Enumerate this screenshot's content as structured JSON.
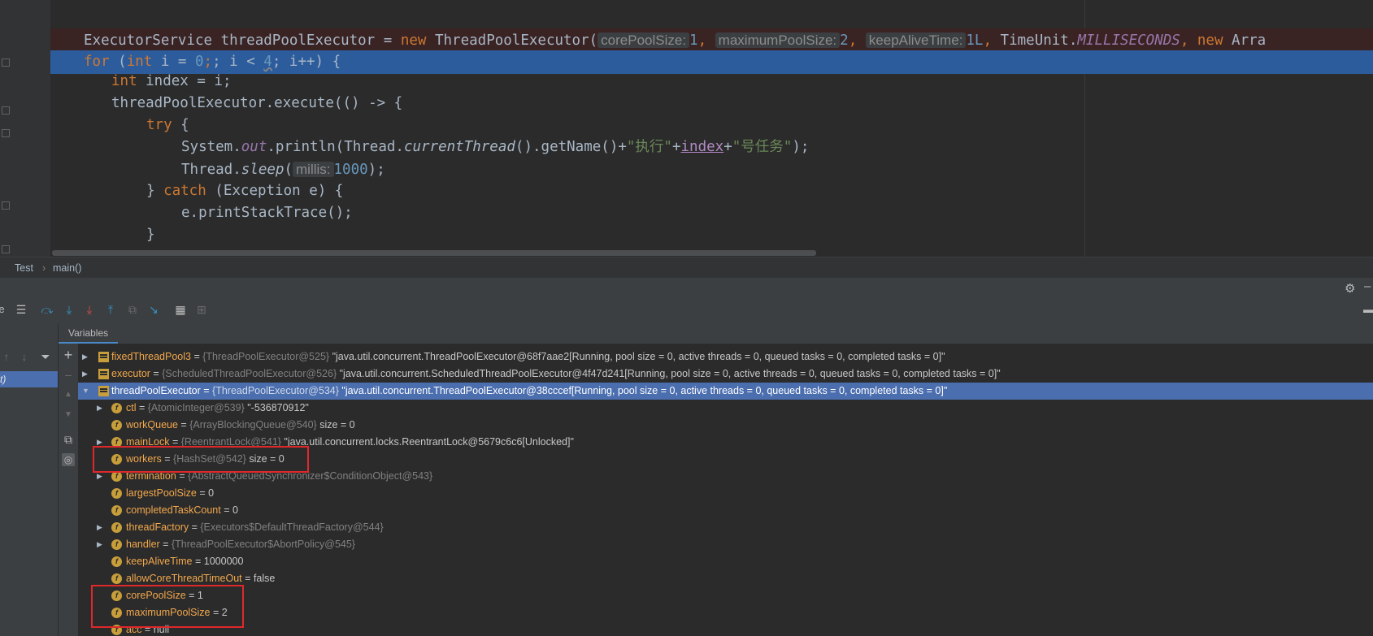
{
  "editor": {
    "line1": {
      "prefix": "ExecutorService threadPoolExecutor = ",
      "new1": "new",
      "ctor": " ThreadPoolExecutor(",
      "hint_core": "corePoolSize:",
      "core_val": "1",
      "comma1": ", ",
      "hint_max": "maximumPoolSize:",
      "max_val": "2",
      "comma2": ", ",
      "hint_keep": "keepAliveTime:",
      "keep_val": "1L",
      "comma3": ", ",
      "timeunit": "TimeUnit.",
      "millis_const": "MILLISECONDS",
      "comma4": ", ",
      "new2": "new",
      "tail": " Arra"
    },
    "line2": {
      "for_kw": "for",
      "paren": " (",
      "int_kw": "int",
      "mid": " i = ",
      "zero": "0",
      "semi1": "; i < ",
      "four": "4",
      "tail": "; i++) {"
    },
    "line3": {
      "int_kw": "int",
      "rest": " index = i;"
    },
    "line4": {
      "text": "threadPoolExecutor.execute(() -> {"
    },
    "line5": {
      "try_kw": "try",
      "rest": " {"
    },
    "line6": {
      "sys": "System.",
      "out": "out",
      "println": ".println(Thread.",
      "current": "currentThread",
      "getname": "().getName()+",
      "str1": "\"执行\"",
      "plus1": "+",
      "index": "index",
      "plus2": "+",
      "str2": "\"号任务\"",
      "end": ");"
    },
    "line7": {
      "thread": "Thread.",
      "sleep": "sleep",
      "open": "(",
      "hint": "millis:",
      "val": "1000",
      "end": ");"
    },
    "line8": {
      "close": "} ",
      "catch_kw": "catch",
      "rest": " (Exception e) {"
    },
    "line9": {
      "text": "e.printStackTrace();"
    },
    "line10": {
      "text": "}"
    }
  },
  "breadcrumb": {
    "class_name": "Test",
    "sep": "›",
    "method": "main()"
  },
  "left_panel": {
    "frame_label": "t)",
    "edge_char": "e"
  },
  "variables_tab": {
    "label": "Variables"
  },
  "variables": [
    {
      "name": "fixedThreadPool3",
      "eq": " = ",
      "type": "{ThreadPoolExecutor@525}",
      "value": " \"java.util.concurrent.ThreadPoolExecutor@68f7aae2[Running, pool size = 0, active threads = 0, queued tasks = 0, completed tasks = 0]\""
    },
    {
      "name": "executor",
      "eq": " = ",
      "type": "{ScheduledThreadPoolExecutor@526}",
      "value": " \"java.util.concurrent.ScheduledThreadPoolExecutor@4f47d241[Running, pool size = 0, active threads = 0, queued tasks = 0, completed tasks = 0]\""
    },
    {
      "name": "threadPoolExecutor",
      "eq": " = ",
      "type": "{ThreadPoolExecutor@534}",
      "value": " \"java.util.concurrent.ThreadPoolExecutor@38cccef[Running, pool size = 0, active threads = 0, queued tasks = 0, completed tasks = 0]\""
    },
    {
      "name": "ctl",
      "eq": " = ",
      "type": "{AtomicInteger@539}",
      "value": " \"-536870912\""
    },
    {
      "name": "workQueue",
      "eq": " = ",
      "type": "{ArrayBlockingQueue@540}",
      "value": "  size = 0"
    },
    {
      "name": "mainLock",
      "eq": " = ",
      "type": "{ReentrantLock@541}",
      "value": " \"java.util.concurrent.locks.ReentrantLock@5679c6c6[Unlocked]\""
    },
    {
      "name": "workers",
      "eq": " = ",
      "type": "{HashSet@542}",
      "value": "  size = 0"
    },
    {
      "name": "termination",
      "eq": " = ",
      "type": "{AbstractQueuedSynchronizer$ConditionObject@543}",
      "value": ""
    },
    {
      "name": "largestPoolSize",
      "eq": " = ",
      "type": "",
      "value": "0"
    },
    {
      "name": "completedTaskCount",
      "eq": " = ",
      "type": "",
      "value": "0"
    },
    {
      "name": "threadFactory",
      "eq": " = ",
      "type": "{Executors$DefaultThreadFactory@544}",
      "value": ""
    },
    {
      "name": "handler",
      "eq": " = ",
      "type": "{ThreadPoolExecutor$AbortPolicy@545}",
      "value": ""
    },
    {
      "name": "keepAliveTime",
      "eq": " = ",
      "type": "",
      "value": "1000000"
    },
    {
      "name": "allowCoreThreadTimeOut",
      "eq": " = ",
      "type": "",
      "value": "false"
    },
    {
      "name": "corePoolSize",
      "eq": " = ",
      "type": "",
      "value": "1"
    },
    {
      "name": "maximumPoolSize",
      "eq": " = ",
      "type": "",
      "value": "2"
    },
    {
      "name": "acc",
      "eq": " = ",
      "type": "",
      "value": "null"
    }
  ],
  "icons": {
    "field": "f",
    "expand": "▶",
    "collapse": "▼",
    "add": "+",
    "gear": "⚙",
    "minimize": "–"
  }
}
